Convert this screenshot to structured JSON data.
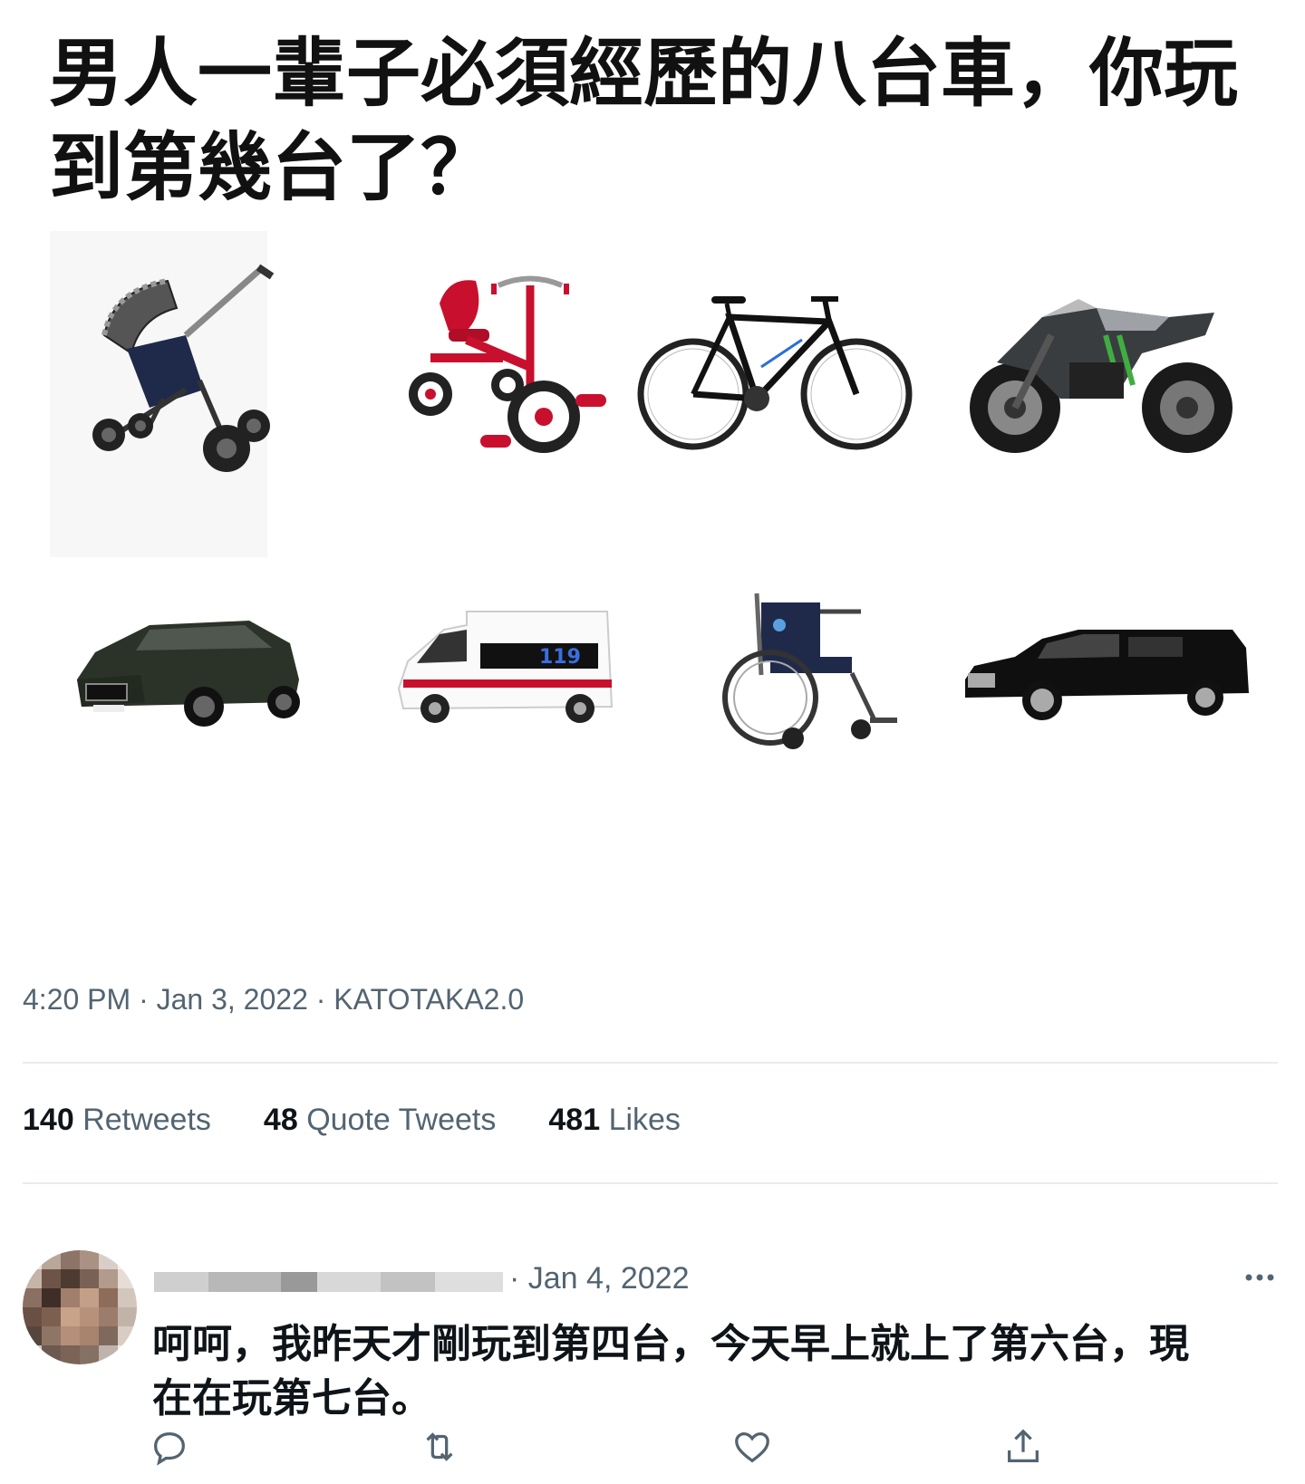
{
  "post": {
    "headline": "男人一輩子必須經歷的八台車，你玩到第幾台了？",
    "vehicles": [
      {
        "name": "stroller"
      },
      {
        "name": "tricycle"
      },
      {
        "name": "bicycle"
      },
      {
        "name": "motorcycle"
      },
      {
        "name": "suv"
      },
      {
        "name": "ambulance",
        "label": "119"
      },
      {
        "name": "wheelchair"
      },
      {
        "name": "hearse"
      }
    ],
    "time": "4:20 PM",
    "date": "Jan 3, 2022",
    "source": "KATOTAKA2.0",
    "separator": " · "
  },
  "stats": {
    "retweets": {
      "count": "140",
      "label": "Retweets"
    },
    "quotes": {
      "count": "48",
      "label": "Quote Tweets"
    },
    "likes": {
      "count": "481",
      "label": "Likes"
    }
  },
  "reply": {
    "date": "· Jan 4, 2022",
    "text": "呵呵，我昨天才剛玩到第四台，今天早上就上了第六台，現在在玩第七台。"
  },
  "icons": {
    "more": "more-icon",
    "reply": "reply-icon",
    "retweet": "retweet-icon",
    "like": "heart-icon",
    "share": "share-icon"
  },
  "colors": {
    "text": "#0f1419",
    "secondary": "#536471",
    "divider": "#e6ecf0"
  }
}
